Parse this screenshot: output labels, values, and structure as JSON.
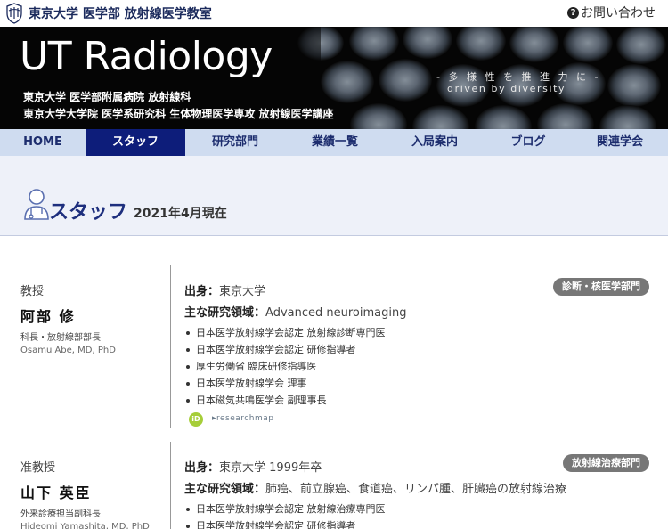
{
  "header": {
    "logo_text": "東京大学 医学部 放射線医学教室",
    "contact_label": "お問い合わせ"
  },
  "hero": {
    "title": "UT Radiology",
    "subtitle_line1": "東京大学 医学部附属病院 放射線科",
    "subtitle_line2": "東京大学大学院 医学系研究科 生体物理医学専攻 放射線医学講座",
    "tagline_jp": "- 多 様 性 を 推 進 力 に -",
    "tagline_en": "driven by diversity"
  },
  "nav": {
    "items": [
      {
        "label": "HOME"
      },
      {
        "label": "スタッフ"
      },
      {
        "label": "研究部門"
      },
      {
        "label": "業績一覧"
      },
      {
        "label": "入局案内"
      },
      {
        "label": "ブログ"
      },
      {
        "label": "関連学会"
      }
    ],
    "active_index": 1
  },
  "page": {
    "title": "スタッフ",
    "date": "2021年4月現在"
  },
  "staff": [
    {
      "role": "教授",
      "name": "阿部 修",
      "positions": "科長・放射線部部長",
      "name_en": "Osamu Abe, MD, PhD",
      "origin_label": "出身",
      "origin": "東京大学",
      "field_label": "主な研究領域",
      "field": "Advanced neuroimaging",
      "department": "診断・核医学部門",
      "certifications": [
        "日本医学放射線学会認定 放射線診断専門医",
        "日本医学放射線学会認定 研修指導者",
        "厚生労働省 臨床研修指導医",
        "日本医学放射線学会 理事",
        "日本磁気共鳴医学会 副理事長"
      ],
      "orcid_label": "iD",
      "researchmap_label": "▸researchmap"
    },
    {
      "role": "准教授",
      "name": "山下 英臣",
      "positions": "外来診療担当副科長",
      "name_en": "Hideomi Yamashita, MD, PhD",
      "origin_label": "出身",
      "origin": "東京大学 1999年卒",
      "field_label": "主な研究領域",
      "field": "肺癌、前立腺癌、食道癌、リンパ腫、肝臓癌の放射線治療",
      "department": "放射線治療部門",
      "certifications": [
        "日本医学放射線学会認定 放射線治療専門医",
        "日本医学放射線学会認定 研修指導者"
      ]
    }
  ]
}
